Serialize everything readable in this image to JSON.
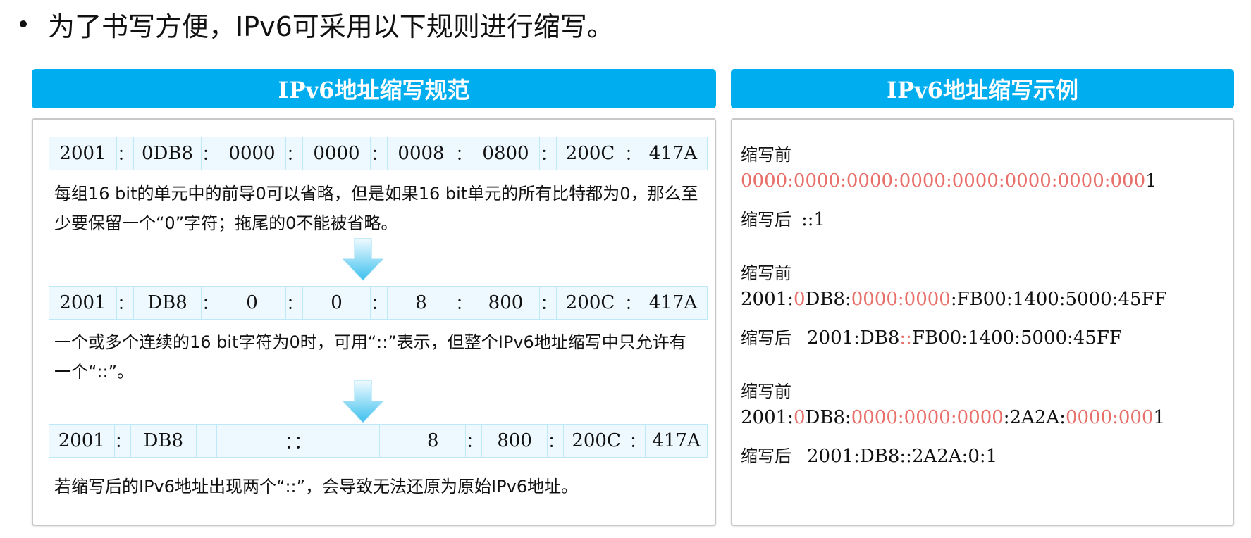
{
  "intro": "为了书写方便，IPv6可采用以下规则进行缩写。",
  "left_title": "IPv6地址缩写规范",
  "right_title": "IPv6地址缩写示例",
  "sep": "：",
  "rows": {
    "row1": [
      "2001",
      "0DB8",
      "0000",
      "0000",
      "0008",
      "0800",
      "200C",
      "417A"
    ],
    "row2": [
      "2001",
      "DB8",
      "0",
      "0",
      "8",
      "800",
      "200C",
      "417A"
    ],
    "row3": {
      "g1": "2001",
      "g2": "DB8",
      "middle": "：：",
      "g5": "8",
      "g6": "800",
      "g7": "200C",
      "g8": "417A"
    }
  },
  "descs": {
    "d1": "每组16 bit的单元中的前导0可以省略，但是如果16 bit单元的所有比特都为0，那么至少要保留一个“0”字符；拖尾的0不能被省略。",
    "d2": "一个或多个连续的16 bit字符为0时，可用“::”表示，但整个IPv6地址缩写中只允许有一个“::”。",
    "d3": "若缩写后的IPv6地址出现两个“::”，会导致无法还原为原始IPv6地址。"
  },
  "examples": {
    "before_label": "缩写前",
    "after_label": "缩写后",
    "ex1": {
      "red": "0000:0000:0000:0000:0000:0000:0000:000",
      "black": "1",
      "after": "::1"
    },
    "ex2": {
      "p1": "2001:",
      "p2": "0",
      "p3": "DB8:",
      "p4": "0000:0000",
      "p5": ":FB00:1400:5000:45FF",
      "after_p1": "2001:DB8",
      "after_p2": "::",
      "after_p3": "FB00:1400:5000:45FF"
    },
    "ex3": {
      "p1": "2001:",
      "p2": "0",
      "p3": "DB8:",
      "p4": "0000:0000:0000",
      "p5": ":2A2A:",
      "p6": "0000:000",
      "p7": "1",
      "after": "2001:DB8::2A2A:0:1"
    }
  },
  "colors": {
    "header": "#00aeef",
    "highlight": "#e8706a",
    "cell_border": "#bfe8f8"
  }
}
